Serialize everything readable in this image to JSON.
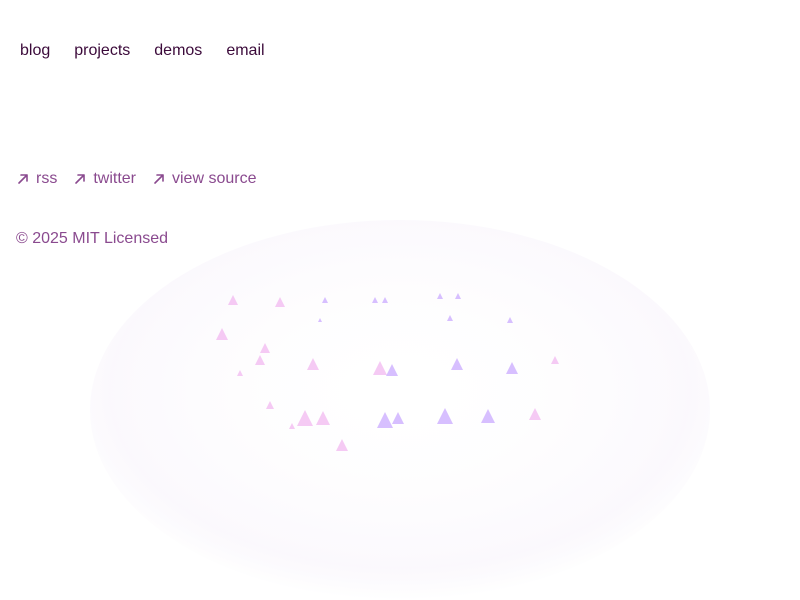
{
  "nav": {
    "items": [
      {
        "label": "blog"
      },
      {
        "label": "projects"
      },
      {
        "label": "demos"
      },
      {
        "label": "email"
      }
    ]
  },
  "footer_links": {
    "items": [
      {
        "label": "rss",
        "icon": "arrow-up-right-icon"
      },
      {
        "label": "twitter",
        "icon": "arrow-up-right-icon"
      },
      {
        "label": "view source",
        "icon": "arrow-up-right-icon"
      }
    ]
  },
  "copyright": {
    "text": "© 2025 MIT Licensed"
  },
  "colors": {
    "nav_text": "#3b0a3a",
    "link_text": "#8a4a8f",
    "art_pink": "#f2b8f0",
    "art_purple": "#c9a9ff",
    "background": "#ffffff"
  }
}
